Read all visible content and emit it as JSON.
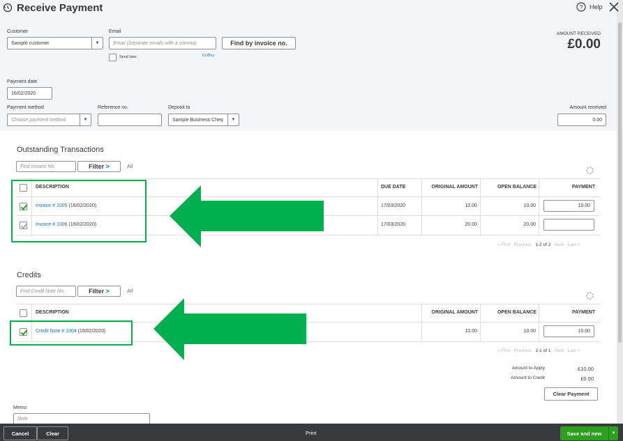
{
  "header": {
    "title": "Receive Payment",
    "help_label": "Help",
    "amount_received_label": "AMOUNT RECEIVED",
    "amount_received_value": "£0.00"
  },
  "form": {
    "customer_label": "Customer",
    "customer_value": "Sample customer",
    "email_label": "Email",
    "email_placeholder": "Email (Separate emails with a comma)",
    "send_later_label": "Send later",
    "ccbcc_label": "Cc/Bcc",
    "find_invoice_button": "Find by invoice no.",
    "payment_date_label": "Payment date",
    "payment_date_value": "16/02/2020",
    "payment_method_label": "Payment method",
    "payment_method_placeholder": "Choose payment method",
    "reference_label": "Reference no.",
    "reference_value": "",
    "deposit_label": "Deposit to",
    "deposit_value": "Sample Business Cheq",
    "amount_received_label": "Amount received",
    "amount_received_value": "0.00"
  },
  "outstanding": {
    "title": "Outstanding Transactions",
    "search_placeholder": "Find Invoice No.",
    "filter_label": "Filter",
    "filter_chevron": ">",
    "all_label": "All",
    "columns": [
      "DESCRIPTION",
      "DUE DATE",
      "ORIGINAL AMOUNT",
      "OPEN BALANCE",
      "PAYMENT"
    ],
    "rows": [
      {
        "link": "Invoice # 1005",
        "date": "(16/02/2020)",
        "due": "17/03/2020",
        "original": "10.00",
        "open": "10.00",
        "payment": "10.00",
        "checked": true
      },
      {
        "link": "Invoice # 1006",
        "date": "(16/02/2020)",
        "due": "17/03/2020",
        "original": "20.00",
        "open": "20.00",
        "payment": "",
        "checked": true
      }
    ],
    "pager": {
      "first": "< First",
      "previous": "Previous",
      "range": "1-2 of 2",
      "next": "Next",
      "last": "Last >"
    }
  },
  "credits": {
    "title": "Credits",
    "search_placeholder": "Find Credit Note No.",
    "filter_label": "Filter",
    "filter_chevron": ">",
    "all_label": "All",
    "columns": [
      "DESCRIPTION",
      "ORIGINAL AMOUNT",
      "OPEN BALANCE",
      "PAYMENT"
    ],
    "rows": [
      {
        "link": "Credit Note # 1004",
        "date": "(16/02/2020)",
        "original": "10.00",
        "open": "10.00",
        "payment": "10.00",
        "checked": true
      }
    ],
    "pager": {
      "first": "< First",
      "previous": "Previous",
      "range": "1-1 of 1",
      "next": "Next",
      "last": "Last >"
    }
  },
  "totals": {
    "apply_label": "Amount to Apply",
    "apply_value": "£10.00",
    "credit_label": "Amount to Credit",
    "credit_value": "£0.00",
    "clear_payment_button": "Clear Payment"
  },
  "memo": {
    "label": "Memo",
    "placeholder": "Note"
  },
  "footer": {
    "cancel": "Cancel",
    "clear": "Clear",
    "print": "Print",
    "save": "Save and new"
  },
  "colors": {
    "accent_green": "#2ca01c",
    "annotation_green": "#00b050",
    "link_blue": "#0077c5",
    "footer_bg": "#393a3d"
  },
  "icons": [
    "history-icon",
    "help-icon",
    "close-icon",
    "gear-icon",
    "chevron-down-icon",
    "annotation-arrow"
  ]
}
